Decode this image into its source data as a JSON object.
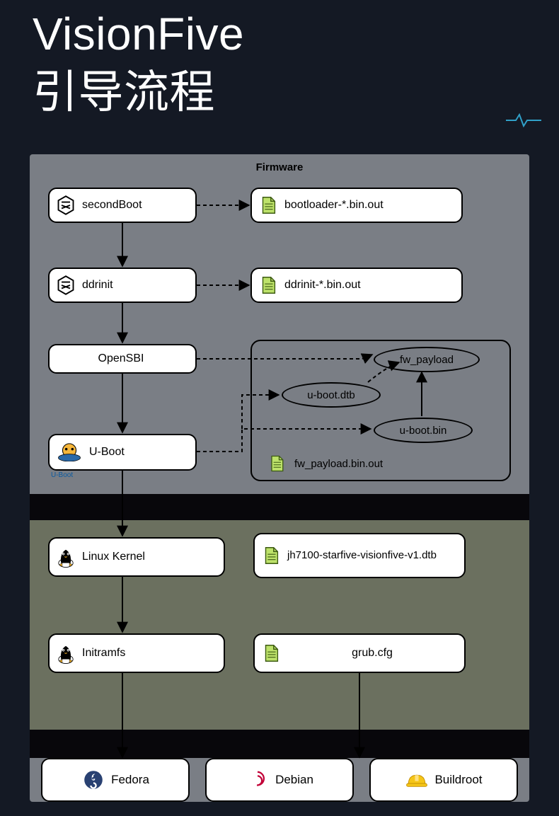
{
  "title": {
    "line1": "VisionFive",
    "line2": "引导流程"
  },
  "sections": {
    "firmware": {
      "label": "Firmware"
    }
  },
  "nodes": {
    "secondBoot": "secondBoot",
    "ddrinit": "ddrinit",
    "opensbi": "OpenSBI",
    "uboot": "U-Boot",
    "uboot_caption": "U-Boot",
    "file_bootloader": "bootloader-*.bin.out",
    "file_ddrinit": "ddrinit-*.bin.out",
    "oval_uboot_dtb": "u-boot.dtb",
    "oval_uboot_bin": "u-boot.bin",
    "oval_fw_payload": "fw_payload",
    "file_fw_payload": "fw_payload.bin.out",
    "linux_kernel": "Linux Kernel",
    "file_dtb": "jh7100-starfive-visionfive-v1.dtb",
    "initramfs": "Initramfs",
    "file_grub": "grub.cfg"
  },
  "distros": {
    "fedora": "Fedora",
    "debian": "Debian",
    "buildroot": "Buildroot"
  }
}
